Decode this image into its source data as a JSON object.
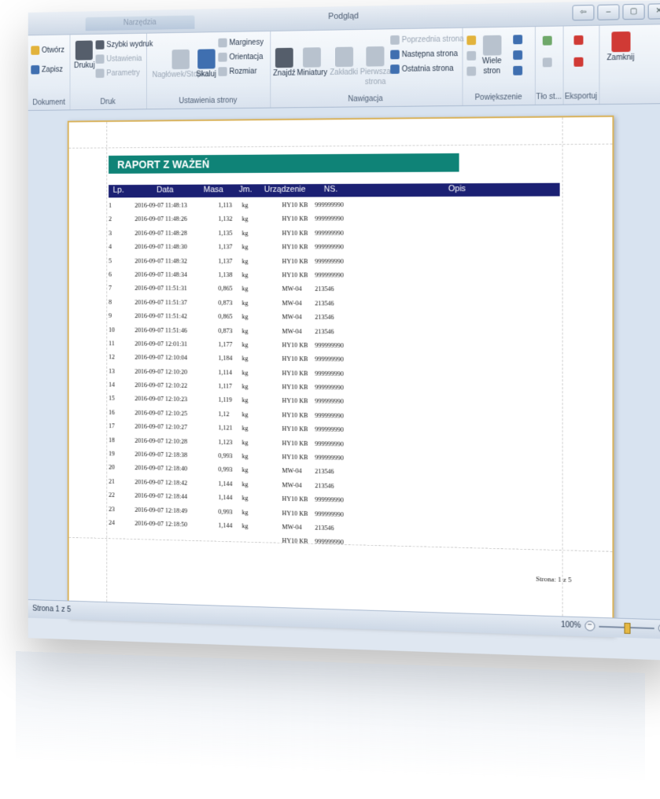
{
  "window": {
    "title": "Podgląd",
    "context_tab": "Narzędzia",
    "buttons": [
      "⇦",
      "–",
      "▢",
      "✕"
    ]
  },
  "ribbon": {
    "dokument": {
      "label": "Dokument",
      "open": "Otwórz",
      "save": "Zapisz"
    },
    "druk": {
      "label": "Druk",
      "print": "Drukuj",
      "quick": "Szybki wydruk",
      "settings": "Ustawienia",
      "params": "Parametry"
    },
    "ustawienia": {
      "label": "Ustawienia strony",
      "header_footer": "Nagłówek/Stopka",
      "scale": "Skaluj",
      "margins": "Marginesy",
      "orientation": "Orientacja",
      "size": "Rozmiar"
    },
    "nawigacja": {
      "label": "Nawigacja",
      "find": "Znajdź",
      "thumbs": "Miniatury",
      "bookmarks": "Zakładki",
      "first1": "Pierwsza",
      "first2": "strona",
      "prev": "Poprzednia strona",
      "next": "Następna strona",
      "last": "Ostatnia strona"
    },
    "powiekszenie": {
      "label": "Powiększenie",
      "many1": "Wiele",
      "many2": "stron"
    },
    "tlo": {
      "label": "Tło st..."
    },
    "eksport": {
      "label": "Eksportuj"
    },
    "close": {
      "label": "Zamknij"
    }
  },
  "report": {
    "title": "RAPORT Z WAŻEŃ",
    "columns": {
      "lp": "Lp.",
      "data": "Data",
      "masa": "Masa",
      "jm": "Jm.",
      "urz": "Urządzenie",
      "ns": "NS.",
      "opis": "Opis"
    },
    "rows": [
      {
        "lp": "1",
        "data": "2016-09-07 11:48:13",
        "masa": "1,113",
        "jm": "kg",
        "urz": "HY10 KB",
        "ns": "999999990"
      },
      {
        "lp": "2",
        "data": "2016-09-07 11:48:26",
        "masa": "1,132",
        "jm": "kg",
        "urz": "HY10 KB",
        "ns": "999999990"
      },
      {
        "lp": "3",
        "data": "2016-09-07 11:48:28",
        "masa": "1,135",
        "jm": "kg",
        "urz": "HY10 KB",
        "ns": "999999990"
      },
      {
        "lp": "4",
        "data": "2016-09-07 11:48:30",
        "masa": "1,137",
        "jm": "kg",
        "urz": "HY10 KB",
        "ns": "999999990"
      },
      {
        "lp": "5",
        "data": "2016-09-07 11:48:32",
        "masa": "1,137",
        "jm": "kg",
        "urz": "HY10 KB",
        "ns": "999999990"
      },
      {
        "lp": "6",
        "data": "2016-09-07 11:48:34",
        "masa": "1,138",
        "jm": "kg",
        "urz": "HY10 KB",
        "ns": "999999990"
      },
      {
        "lp": "7",
        "data": "2016-09-07 11:51:31",
        "masa": "0,865",
        "jm": "kg",
        "urz": "MW-04",
        "ns": "213546"
      },
      {
        "lp": "8",
        "data": "2016-09-07 11:51:37",
        "masa": "0,873",
        "jm": "kg",
        "urz": "MW-04",
        "ns": "213546"
      },
      {
        "lp": "9",
        "data": "2016-09-07 11:51:42",
        "masa": "0,865",
        "jm": "kg",
        "urz": "MW-04",
        "ns": "213546"
      },
      {
        "lp": "10",
        "data": "2016-09-07 11:51:46",
        "masa": "0,873",
        "jm": "kg",
        "urz": "MW-04",
        "ns": "213546"
      },
      {
        "lp": "11",
        "data": "2016-09-07 12:01:31",
        "masa": "1,177",
        "jm": "kg",
        "urz": "HY10 KB",
        "ns": "999999990"
      },
      {
        "lp": "12",
        "data": "2016-09-07 12:10:04",
        "masa": "1,184",
        "jm": "kg",
        "urz": "HY10 KB",
        "ns": "999999990"
      },
      {
        "lp": "13",
        "data": "2016-09-07 12:10:20",
        "masa": "1,114",
        "jm": "kg",
        "urz": "HY10 KB",
        "ns": "999999990"
      },
      {
        "lp": "14",
        "data": "2016-09-07 12:10:22",
        "masa": "1,117",
        "jm": "kg",
        "urz": "HY10 KB",
        "ns": "999999990"
      },
      {
        "lp": "15",
        "data": "2016-09-07 12:10:23",
        "masa": "1,119",
        "jm": "kg",
        "urz": "HY10 KB",
        "ns": "999999990"
      },
      {
        "lp": "16",
        "data": "2016-09-07 12:10:25",
        "masa": "1,12",
        "jm": "kg",
        "urz": "HY10 KB",
        "ns": "999999990"
      },
      {
        "lp": "17",
        "data": "2016-09-07 12:10:27",
        "masa": "1,121",
        "jm": "kg",
        "urz": "HY10 KB",
        "ns": "999999990"
      },
      {
        "lp": "18",
        "data": "2016-09-07 12:10:28",
        "masa": "1,123",
        "jm": "kg",
        "urz": "HY10 KB",
        "ns": "999999990"
      },
      {
        "lp": "19",
        "data": "2016-09-07 12:18:38",
        "masa": "0,993",
        "jm": "kg",
        "urz": "HY10 KB",
        "ns": "999999990"
      },
      {
        "lp": "20",
        "data": "2016-09-07 12:18:40",
        "masa": "0,993",
        "jm": "kg",
        "urz": "MW-04",
        "ns": "213546"
      },
      {
        "lp": "21",
        "data": "2016-09-07 12:18:42",
        "masa": "1,144",
        "jm": "kg",
        "urz": "MW-04",
        "ns": "213546"
      },
      {
        "lp": "22",
        "data": "2016-09-07 12:18:44",
        "masa": "1,144",
        "jm": "kg",
        "urz": "HY10 KB",
        "ns": "999999990"
      },
      {
        "lp": "23",
        "data": "2016-09-07 12:18:49",
        "masa": "0,993",
        "jm": "kg",
        "urz": "HY10 KB",
        "ns": "999999990"
      },
      {
        "lp": "24",
        "data": "2016-09-07 12:18:50",
        "masa": "1,144",
        "jm": "kg",
        "urz": "MW-04",
        "ns": "213546"
      },
      {
        "lp": "",
        "data": "",
        "masa": "",
        "jm": "",
        "urz": "HY10 KB",
        "ns": "999999990"
      }
    ],
    "page_footer": "Strona: 1 z 5"
  },
  "status": {
    "page": "Strona 1 z 5",
    "zoom": "100%"
  },
  "colors": {
    "title_bar": "#0f8377",
    "header_bar": "#1b2073",
    "page_border": "#d9b25a"
  }
}
